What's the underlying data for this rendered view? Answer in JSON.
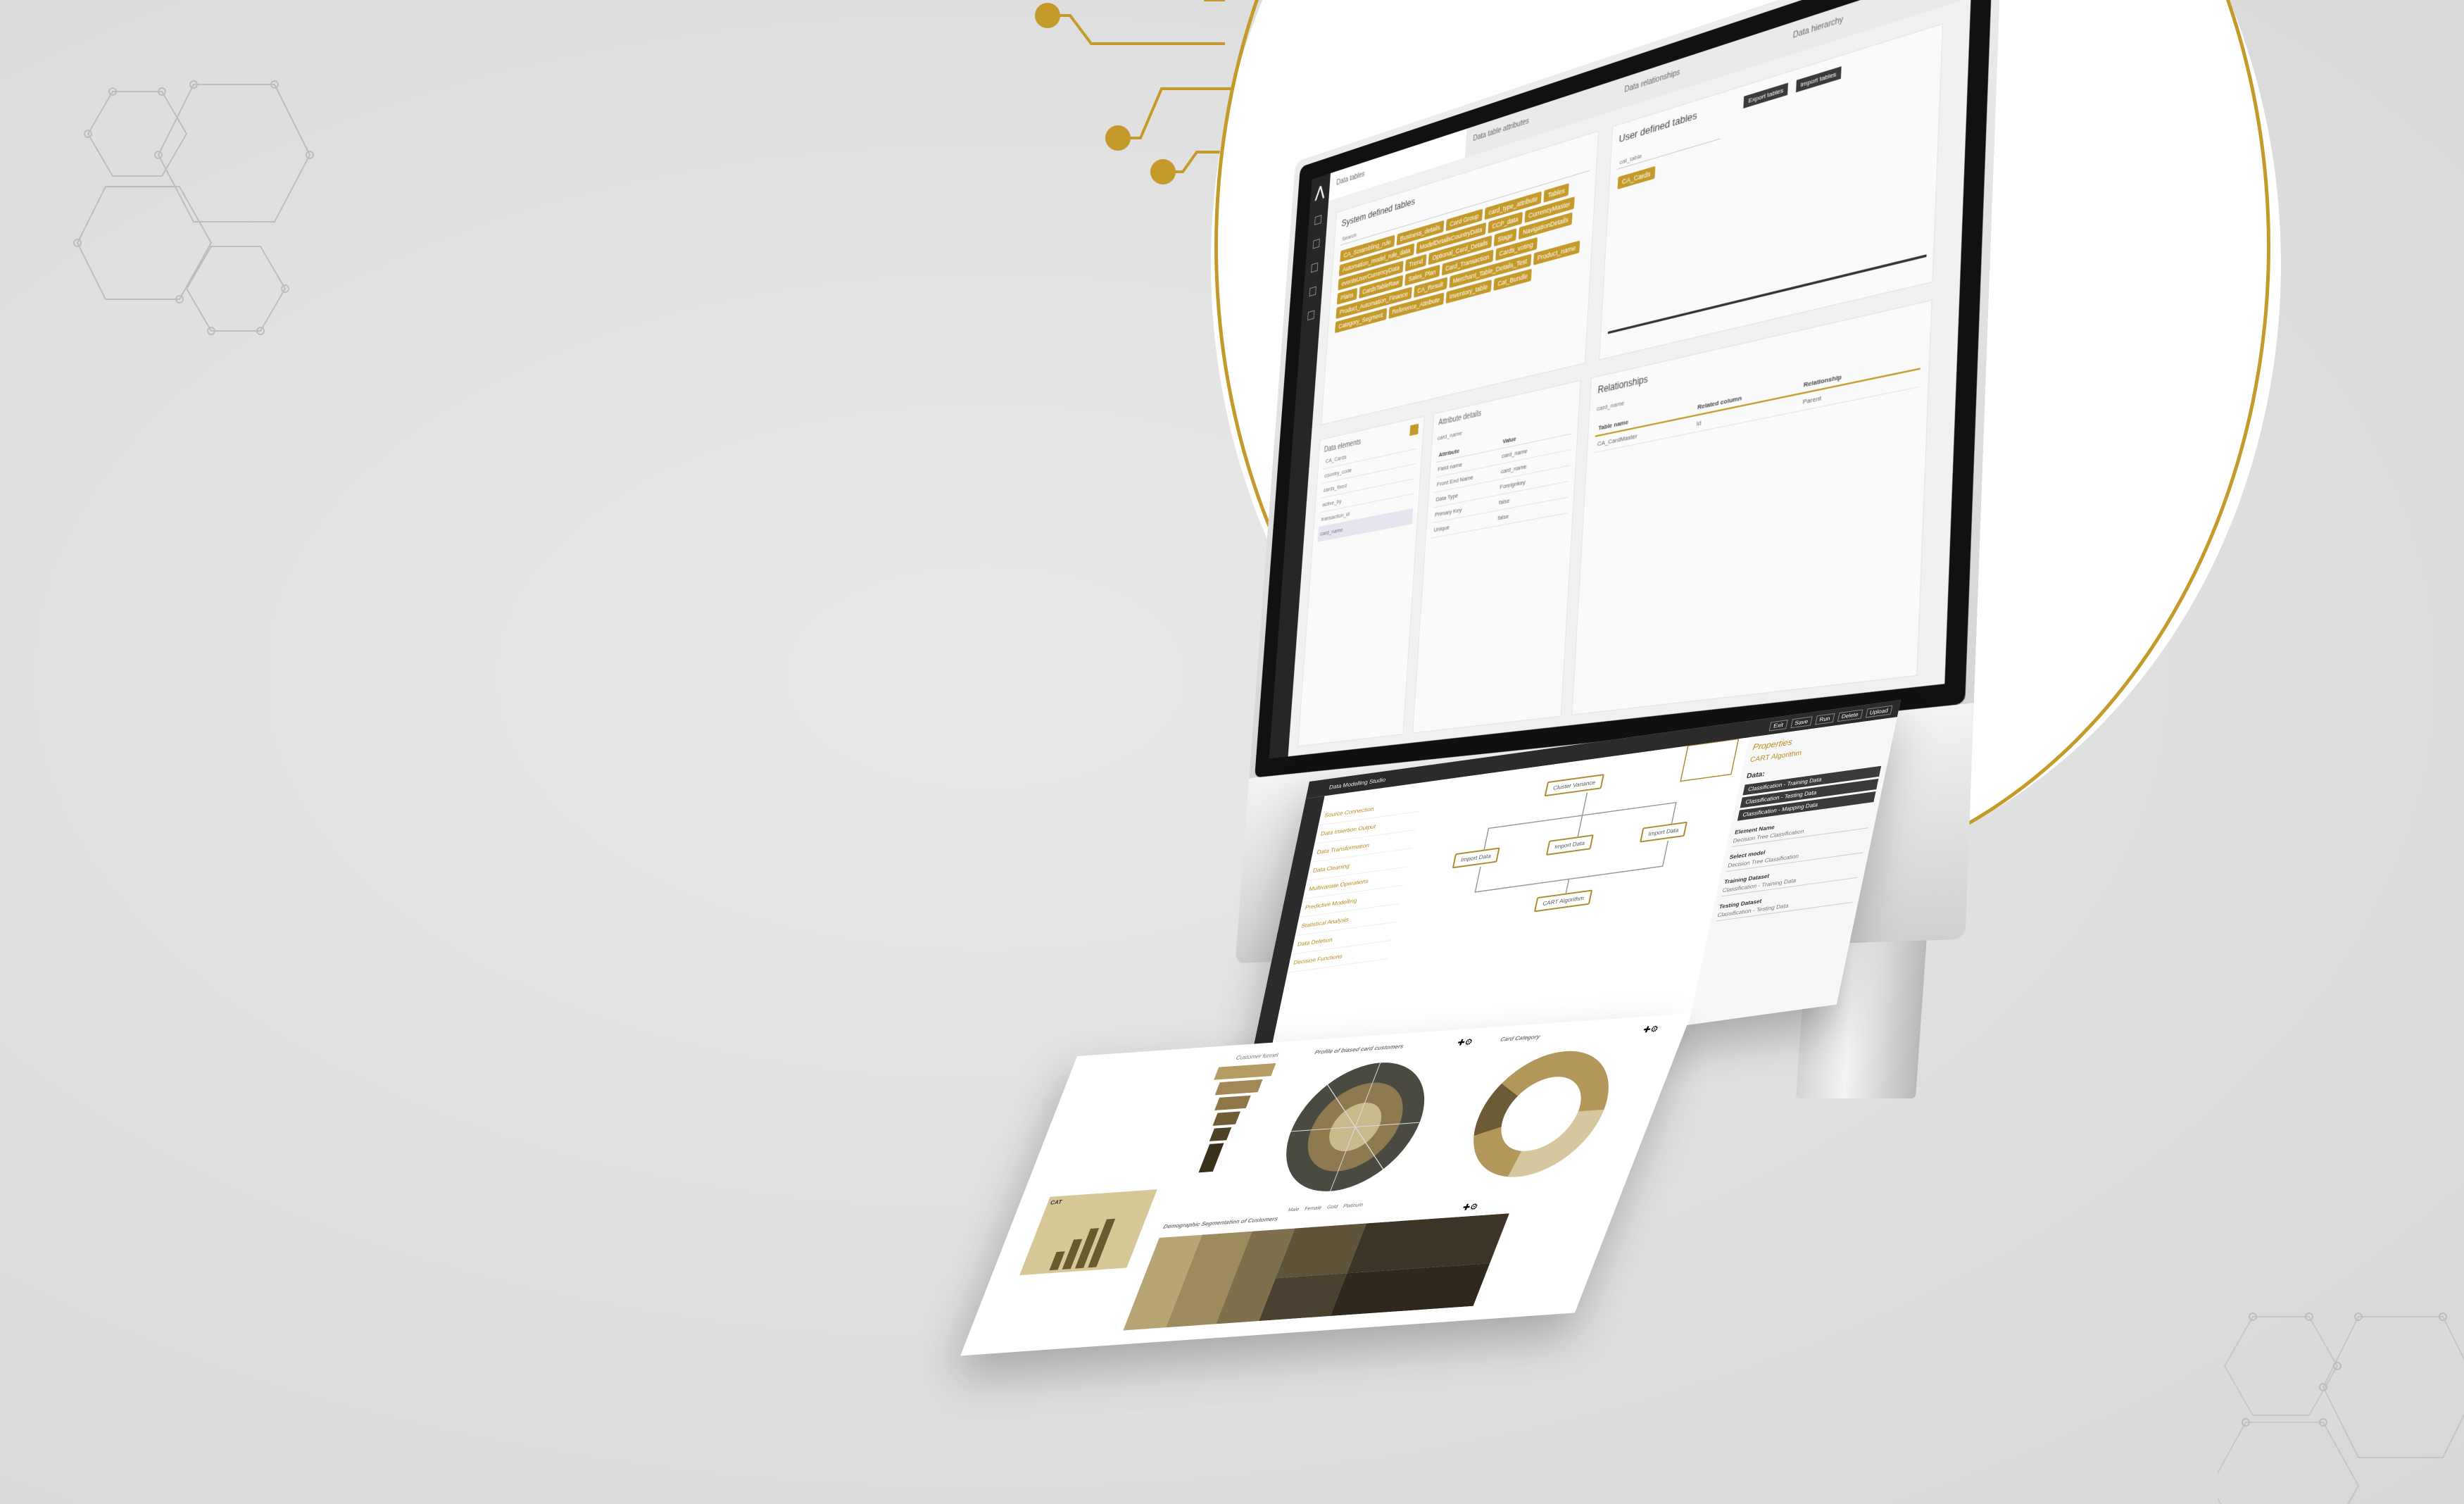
{
  "screen": {
    "tabs": [
      "Data tables",
      "Data table attributes",
      "Data relationships",
      "Data hierarchy"
    ],
    "system_tables": {
      "title": "System defined tables",
      "search_placeholder": "Search",
      "chips": [
        "CA_Scrambling_rule",
        "Business_details",
        "Card Group",
        "card_type_attribute",
        "Tables",
        "Automation_model_rule_data",
        "ModelDetailsCountryData",
        "CCP_data",
        "CurrencyMaster",
        "eventsUserCurrencyData",
        "Trend",
        "Optional_Card_Details",
        "Stage",
        "NavigationDetails",
        "Plans",
        "CardsTableRaw",
        "Sales_Plan",
        "Card_Transaction",
        "Cards_voting",
        "Product_Automation_Finance",
        "CA_Result",
        "Merchant_Table_Details_Test",
        "Product_name",
        "Category_Segment",
        "Reference_Attribute",
        "Inventory_table",
        "Cat_Bundle"
      ]
    },
    "user_tables": {
      "title": "User defined tables",
      "export_label": "Export tables",
      "import_label": "Import tables",
      "search_placeholder": "cat_table",
      "chip": "CA_Cards"
    },
    "data_elements": {
      "title": "Data elements",
      "items": [
        "CA_Cards",
        "country_code",
        "cards_fixed",
        "active_by",
        "transaction_id",
        "card_name"
      ]
    },
    "attribute_details": {
      "title": "Attribute details",
      "name": "card_name",
      "headers": [
        "Attribute",
        "Value"
      ],
      "rows": [
        [
          "Field name",
          "card_name"
        ],
        [
          "Front End Name",
          "card_name"
        ],
        [
          "Data Type",
          "Foreignkey"
        ],
        [
          "Primary Key",
          "false"
        ],
        [
          "Unique",
          "false"
        ]
      ]
    },
    "relationships": {
      "title": "Relationships",
      "subtitle": "card_name",
      "headers": [
        "Table name",
        "Related column",
        "Relationship"
      ],
      "rows": [
        [
          "CA_CardMaster",
          "id",
          "Parent"
        ]
      ]
    }
  },
  "workflow": {
    "menu": [
      "Exit",
      "Save",
      "Run",
      "Delete",
      "Upload"
    ],
    "breadcrumb": "Data Modelling Studio",
    "sidebar": [
      "Source Connection",
      "Data Insertion Output",
      "Data Transformation",
      "Data Cleaning",
      "Multivariate Operations",
      "Predictive Modelling",
      "Statistical Analysis",
      "Data Deletion",
      "Decision Functions"
    ],
    "nodes": {
      "cluster": "Cluster Variance",
      "import1": "Import Data",
      "import2": "Import Data",
      "import3": "Import Data",
      "algo": "CART Algorithm"
    },
    "properties": {
      "title": "Properties",
      "subtitle": "CART Algorithm",
      "data_label": "Data:",
      "data_chips": [
        "Classification - Training Data",
        "Classification - Testing Data",
        "Classification - Mapping Data"
      ],
      "fields": [
        [
          "Element Name",
          "Decision Tree Classification"
        ],
        [
          "Select model",
          "Decision Tree Classification"
        ],
        [
          "Training Dataset",
          "Classification - Training Data"
        ],
        [
          "Testing Dataset",
          "Classification - Testing Data"
        ]
      ]
    }
  },
  "dashboard": {
    "customer_funnel": "Customer funnel",
    "sunburst_title": "Profile of biased card customers",
    "donut_title": "Card Category",
    "demo_title": "Demographic Segmentation of Customers",
    "bar_tile": "CAT",
    "sunburst_legend": [
      "Male",
      "Female",
      "Gold",
      "Platinum"
    ]
  },
  "colors": {
    "gold": "#c49a2a",
    "dark": "#2b2b2b",
    "background": "#e1e1e1"
  }
}
